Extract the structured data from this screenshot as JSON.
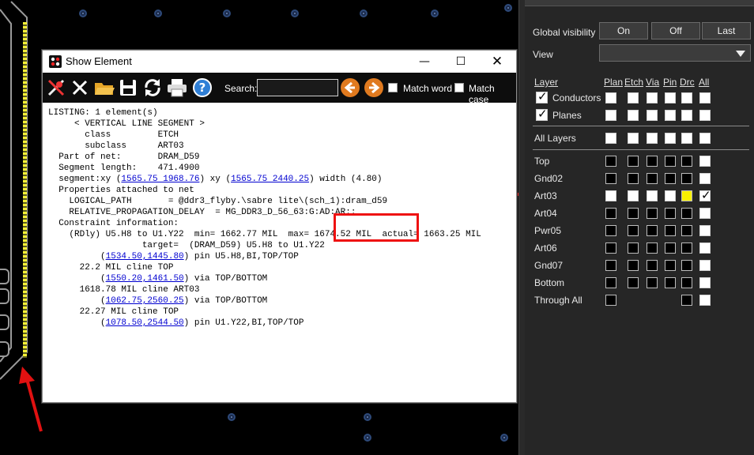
{
  "dialog": {
    "title": "Show Element",
    "search_label": "Search:",
    "search_value": "",
    "match_word_label": "Match word",
    "match_case_label": "Match case",
    "lines": [
      {
        "t": "LISTING: 1 element(s)"
      },
      {
        "t": ""
      },
      {
        "t": "     < VERTICAL LINE SEGMENT >"
      },
      {
        "t": ""
      },
      {
        "t": "       class         ETCH"
      },
      {
        "t": "       subclass      ART03"
      },
      {
        "t": ""
      },
      {
        "t": "  Part of net:       DRAM_D59"
      },
      {
        "t": "  Segment length:    471.4900"
      },
      {
        "t": ""
      },
      {
        "t": "  segment:xy (",
        "l": "1565.75 1968.76",
        "a": ") xy (",
        "l2": "1565.75 2440.25",
        "b": ") width (4.80)"
      },
      {
        "t": ""
      },
      {
        "t": "  Properties attached to net"
      },
      {
        "t": "    LOGICAL_PATH       = @ddr3_flyby.\\sabre lite\\(sch_1):dram_d59"
      },
      {
        "t": "    RELATIVE_PROPAGATION_DELAY  = MG_DDR3_D_56_63:G:AD:AR::"
      },
      {
        "t": ""
      },
      {
        "t": "  Constraint information:"
      },
      {
        "t": "    (RDly) U5.H8 to U1.Y22  min= 1662.77 MIL  max= 1674.52 MIL  actual= 1663.25 MIL"
      },
      {
        "t": "                  target=  (DRAM_D59) U5.H8 to U1.Y22"
      },
      {
        "t": "          (",
        "l": "1534.50,1445.80",
        "a": ") pin U5.H8,BI,TOP/TOP"
      },
      {
        "t": "      22.2 MIL cline TOP"
      },
      {
        "t": "          (",
        "l": "1550.20,1461.50",
        "a": ") via TOP/BOTTOM"
      },
      {
        "t": "      1618.78 MIL cline ART03"
      },
      {
        "t": "          (",
        "l": "1062.75,2560.25",
        "a": ") via TOP/BOTTOM"
      },
      {
        "t": "      22.27 MIL cline TOP"
      },
      {
        "t": "          (",
        "l": "1078.50,2544.50",
        "a": ") pin U1.Y22,BI,TOP/TOP"
      }
    ]
  },
  "visibility": {
    "global_label": "Global visibility",
    "buttons": [
      "On",
      "Off",
      "Last"
    ],
    "view_label": "View",
    "view_value": "",
    "layer_header": "Layer",
    "columns": [
      "Plan",
      "Etch",
      "Via",
      "Pin",
      "Drc",
      "All"
    ],
    "top_rows": [
      {
        "name": "Conductors",
        "checked": true,
        "cells": [
          "w",
          "w",
          "w",
          "w",
          "w",
          "w"
        ]
      },
      {
        "name": "Planes",
        "checked": true,
        "cells": [
          "w",
          "w",
          "w",
          "w",
          "w",
          "w"
        ]
      }
    ],
    "all_layers": {
      "name": "All Layers",
      "cells": [
        "w",
        "w",
        "w",
        "w",
        "w",
        "w"
      ]
    },
    "layers": [
      {
        "name": "Top",
        "cells": [
          "d",
          "d",
          "d",
          "d",
          "d",
          "w"
        ]
      },
      {
        "name": "Gnd02",
        "cells": [
          "d",
          "d",
          "d",
          "d",
          "d",
          "w"
        ]
      },
      {
        "name": "Art03",
        "cells": [
          "w",
          "w",
          "w",
          "w",
          "y",
          "c"
        ]
      },
      {
        "name": "Art04",
        "cells": [
          "d",
          "d",
          "d",
          "d",
          "d",
          "w"
        ]
      },
      {
        "name": "Pwr05",
        "cells": [
          "d",
          "d",
          "d",
          "d",
          "d",
          "w"
        ]
      },
      {
        "name": "Art06",
        "cells": [
          "d",
          "d",
          "d",
          "d",
          "d",
          "w"
        ]
      },
      {
        "name": "Gnd07",
        "cells": [
          "d",
          "d",
          "d",
          "d",
          "d",
          "w"
        ]
      },
      {
        "name": "Bottom",
        "cells": [
          "d",
          "d",
          "d",
          "d",
          "d",
          "w"
        ]
      },
      {
        "name": "Through All",
        "cells": [
          "d",
          "",
          "",
          "",
          "d",
          "w"
        ]
      }
    ]
  },
  "colors": {
    "trace": "#f4f034",
    "annotation": "#e11111",
    "panel_bg": "#262626"
  }
}
